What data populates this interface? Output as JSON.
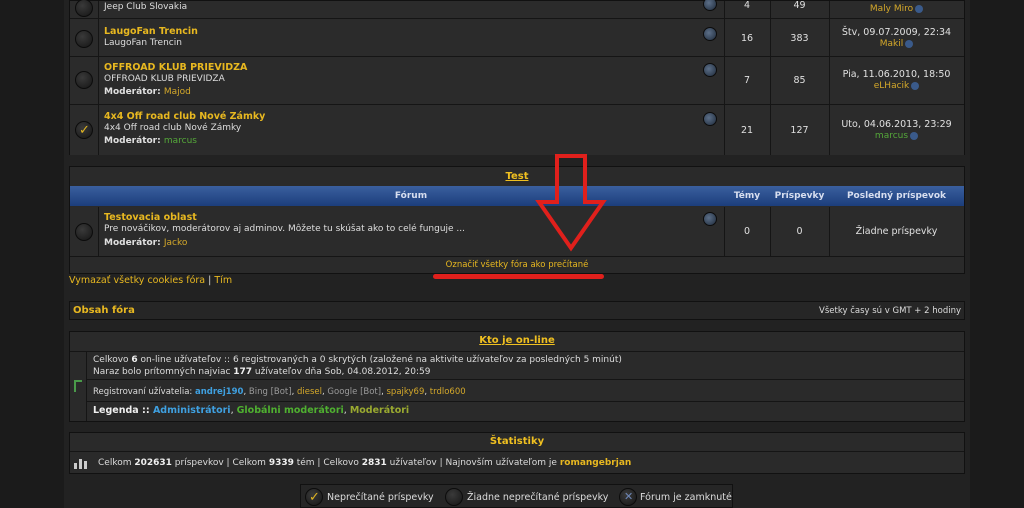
{
  "forums_top": [
    {
      "desc": "Jeep Club Slovakia",
      "topics": "4",
      "posts": "49",
      "last_user": "Maly Miro"
    },
    {
      "name": "LaugoFan Trencin",
      "desc": "LaugoFan Trencin",
      "topics": "16",
      "posts": "383",
      "last_date": "Štv, 09.07.2009, 22:34",
      "last_user": "Makil"
    },
    {
      "name": "OFFROAD KLUB PRIEVIDZA",
      "desc": "OFFROAD KLUB PRIEVIDZA",
      "mod_label": "Moderátor:",
      "mod": "Majod",
      "topics": "7",
      "posts": "85",
      "last_date": "Pia, 11.06.2010, 18:50",
      "last_user": "eLHacik"
    },
    {
      "name": "4x4 Off road club Nové Zámky",
      "desc": "4x4 Off road club Nové Zámky",
      "mod_label": "Moderátor:",
      "mod": "marcus",
      "topics": "21",
      "posts": "127",
      "last_date": "Uto, 04.06.2013, 23:29",
      "last_user": "marcus"
    }
  ],
  "test_category": {
    "title": "Test",
    "headers": {
      "forum": "Fórum",
      "topics": "Témy",
      "posts": "Príspevky",
      "last": "Posledný príspevok"
    },
    "forum": {
      "name": "Testovacia oblast",
      "desc": "Pre nováčikov, moderátorov aj adminov. Môžete tu skúšat ako to celé funguje ...",
      "mod_label": "Moderátor:",
      "mod": "Jacko",
      "topics": "0",
      "posts": "0",
      "last": "Žiadne príspevky"
    }
  },
  "mark_read": "Označiť všetky fóra ako prečítané",
  "links": {
    "delete_cookies": "Vymazať všetky cookies fóra",
    "sep": "|",
    "team": "Tím"
  },
  "board_bar": {
    "title": "Obsah fóra",
    "timezone": "Všetky časy sú v GMT + 2 hodiny"
  },
  "online": {
    "title": "Kto je on-line",
    "line1_pre": "Celkovo ",
    "line1_count": "6",
    "line1_post": " on-line užívateľov :: 6 registrovaných a 0 skrytých (založené na aktivite užívateľov za posledných 5 minút)",
    "line2_pre": "Naraz bolo prítomných najviac ",
    "line2_count": "177",
    "line2_post": " užívateľov dňa Sob, 04.08.2012, 20:59",
    "registered_label": "Registrovaní užívatelia: ",
    "u1": "andrej190",
    "c1": ", ",
    "u2": "Bing [Bot]",
    "c2": ", ",
    "u3": "diesel",
    "c3": ", ",
    "u4": "Google [Bot]",
    "c4": ", ",
    "u5": "spajky69",
    "c5": ", ",
    "u6": "trdlo600",
    "legend_label": "Legenda :: ",
    "l1": "Administrátori",
    "l2": "Globálni moderátori",
    "l3": "Moderátori",
    "lc": ", "
  },
  "stats": {
    "title": "Štatistiky",
    "p1": "Celkom ",
    "posts": "202631",
    "p2": " príspevkov | Celkom ",
    "topics": "9339",
    "p3": " tém | Celkovo ",
    "users": "2831",
    "p4": " užívateľov | Najnovším užívateľom je ",
    "newest": "romangebrjan"
  },
  "bottom_legend": {
    "unread": "Neprečítané príspevky",
    "no_unread": "Žiadne neprečítané príspevky",
    "locked": "Fórum je zamknuté"
  },
  "colors": {
    "accent": "#e8b820",
    "header_blue": "#2a4f8e",
    "annotation_red": "#e0201c"
  }
}
